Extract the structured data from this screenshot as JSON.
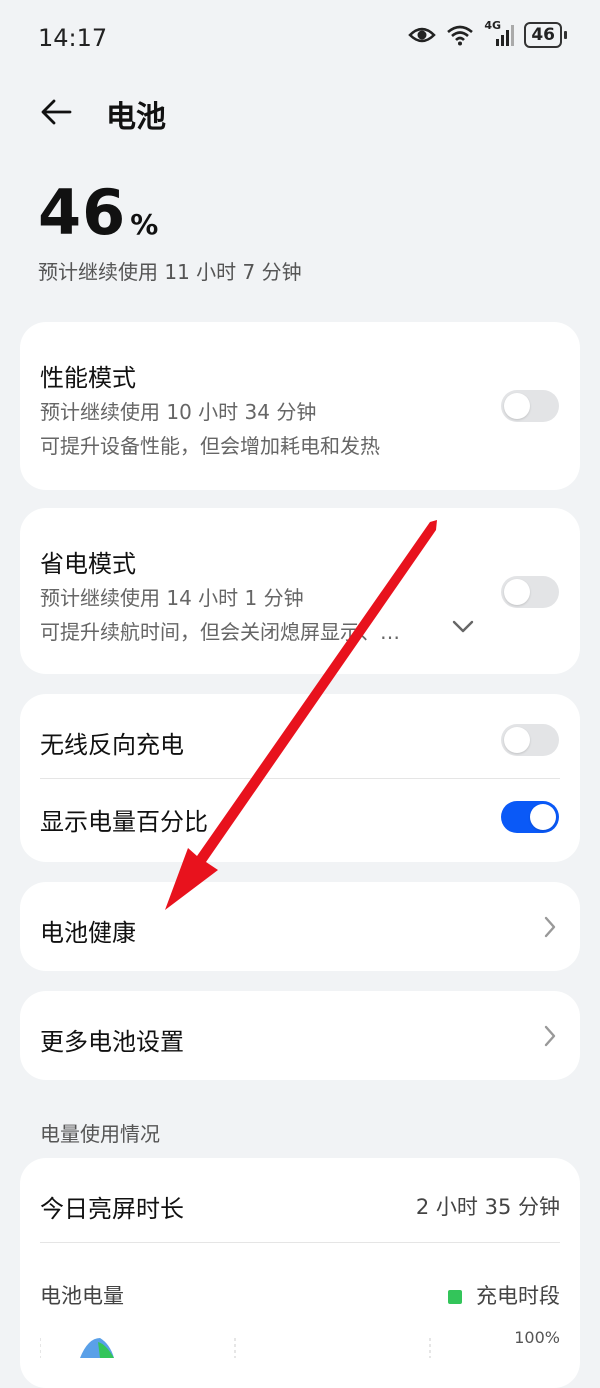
{
  "status_bar": {
    "time": "14:17",
    "network": "4G",
    "battery_level": "46",
    "icons": [
      "eye-icon",
      "wifi-icon",
      "signal-icon",
      "battery-icon"
    ]
  },
  "header": {
    "title": "电池",
    "back_icon": "arrow-left-icon"
  },
  "battery": {
    "percent": "46",
    "unit": "%",
    "estimate": "预计继续使用 11 小时 7 分钟"
  },
  "performance_mode": {
    "title": "性能模式",
    "estimate": "预计继续使用 10 小时 34 分钟",
    "description": "可提升设备性能，但会增加耗电和发热",
    "enabled": false
  },
  "power_saving_mode": {
    "title": "省电模式",
    "estimate": "预计继续使用 14 小时 1 分钟",
    "description": "可提升续航时间，但会关闭熄屏显示、…",
    "enabled": false
  },
  "wireless_reverse_charging": {
    "title": "无线反向充电",
    "enabled": false
  },
  "show_battery_percentage": {
    "title": "显示电量百分比",
    "enabled": true
  },
  "battery_health": {
    "title": "电池健康"
  },
  "more_battery_settings": {
    "title": "更多电池设置"
  },
  "usage": {
    "section_title": "电量使用情况",
    "screen_time_label": "今日亮屏时长",
    "screen_time_value": "2 小时 35 分钟",
    "battery_level_label": "电池电量",
    "legend_charging": "充电时段",
    "axis_max": "100%"
  },
  "colors": {
    "accent": "#0a59f7",
    "charging_legend": "#33c55a",
    "arrow": "#e8121d"
  }
}
